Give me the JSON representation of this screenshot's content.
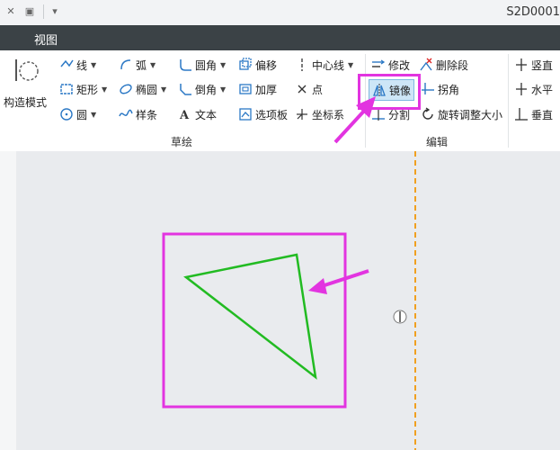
{
  "window": {
    "title": "S2D0001"
  },
  "menubar": {
    "tab_view": "视图"
  },
  "ribbon": {
    "construct_mode": "构造模式",
    "tools": {
      "line": "线",
      "arc": "弧",
      "fillet": "圆角",
      "offset": "偏移",
      "centerline": "中心线",
      "rectangle": "矩形",
      "ellipse": "椭圆",
      "chamfer": "倒角",
      "thicken": "加厚",
      "point": "点",
      "circle": "圆",
      "spline": "样条",
      "text": "文本",
      "palette": "选项板",
      "coord_system": "坐标系",
      "modify": "修改",
      "delete_segment": "删除段",
      "mirror": "镜像",
      "corner": "拐角",
      "divide": "分割",
      "rotate_resize": "旋转调整大小",
      "vertical": "竖直",
      "horizontal": "水平",
      "perpendicular": "垂直"
    },
    "groups": {
      "sketch": "草绘",
      "edit": "编辑"
    }
  },
  "colors": {
    "highlight": "#e234e0",
    "sketch_line": "#22bb22",
    "centerline": "#f0a020",
    "ribbon_bg": "#ffffff",
    "menubar_bg": "#3b4246",
    "canvas_bg": "#e9ebee"
  }
}
